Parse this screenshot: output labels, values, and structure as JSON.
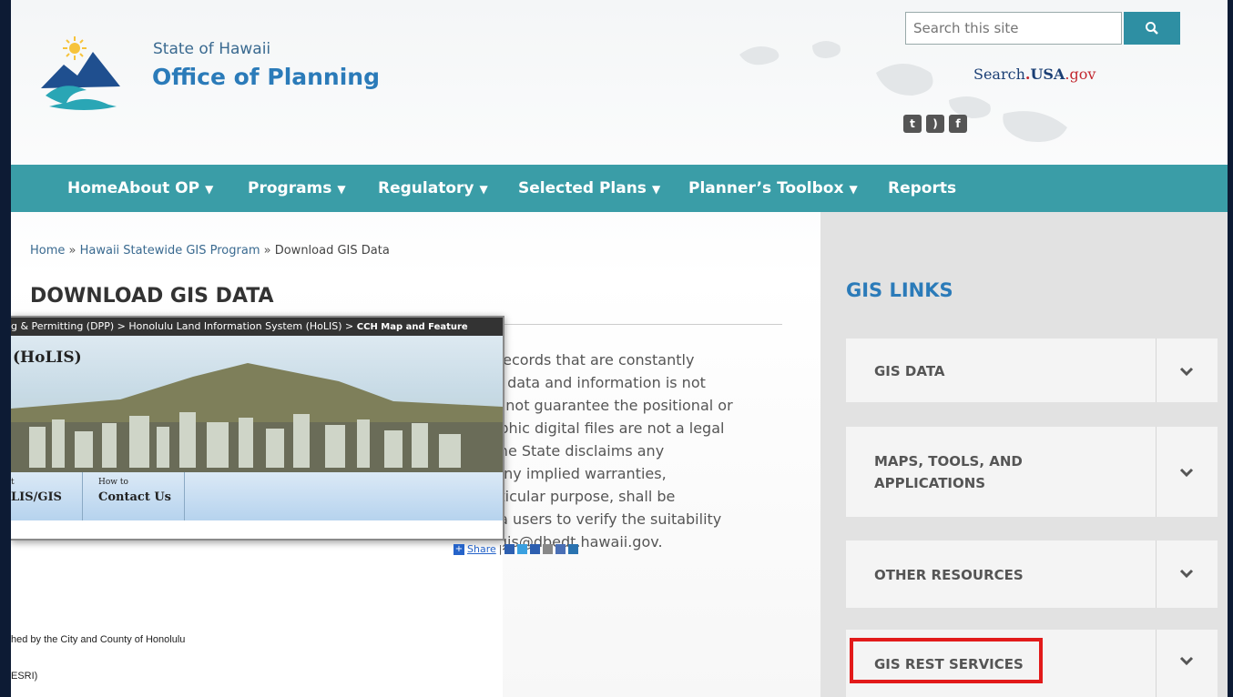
{
  "header": {
    "org_small": "State of Hawaii",
    "org_name": "Office of Planning",
    "search_placeholder": "Search this site",
    "search_usa": {
      "pre": "Search",
      "dot": ".",
      "usa": "USA",
      "gov": ".gov"
    },
    "social": [
      "twitter-icon",
      "rss-icon",
      "facebook-icon"
    ]
  },
  "nav": {
    "items": [
      "Home",
      "About OP",
      "Programs",
      "Regulatory",
      "Selected Plans",
      "Planner’s Toolbox",
      "Reports"
    ],
    "caret": "▼"
  },
  "breadcrumb": {
    "home": "Home",
    "sep": " » ",
    "gis_program": "Hawaii Statewide GIS Program",
    "current": "Download GIS Data"
  },
  "main": {
    "title": "DOWNLOAD GIS DATA",
    "lines": [
      "c records that are constantly",
      "ne data and information is not",
      "es not guarantee the positional or",
      "raphic digital files are not a legal",
      "l the State disclaims any",
      ". Any implied warranties,",
      "articular purpose, shall be",
      "ata users to verify the suitability",
      "o gis@dbedt.hawaii.gov."
    ]
  },
  "sidebar": {
    "title": "GIS LINKS",
    "sections": [
      {
        "label": "GIS DATA"
      },
      {
        "label": "MAPS, TOOLS, AND APPLICATIONS"
      },
      {
        "label": "OTHER RESOURCES"
      },
      {
        "label": "GIS REST SERVICES"
      }
    ]
  },
  "overlay": {
    "crumb": {
      "part1": "g & Permitting (DPP)",
      "sep": " > ",
      "part2": "Honolulu Land Information System (HoLIS)",
      "part3": "CCH Map and Feature"
    },
    "banner_title": "(HoLIS)",
    "tab1": {
      "small": "t",
      "big": "LIS/GIS"
    },
    "tab2": {
      "small": "How to",
      "big": "Contact Us"
    },
    "share_label": "Share",
    "text1": "hed by the City and County of Honolulu",
    "text2": "ESRI)"
  },
  "colors": {
    "nav": "#3a9da7",
    "accent": "#2b7bb9",
    "highlight": "#e21a1a"
  }
}
